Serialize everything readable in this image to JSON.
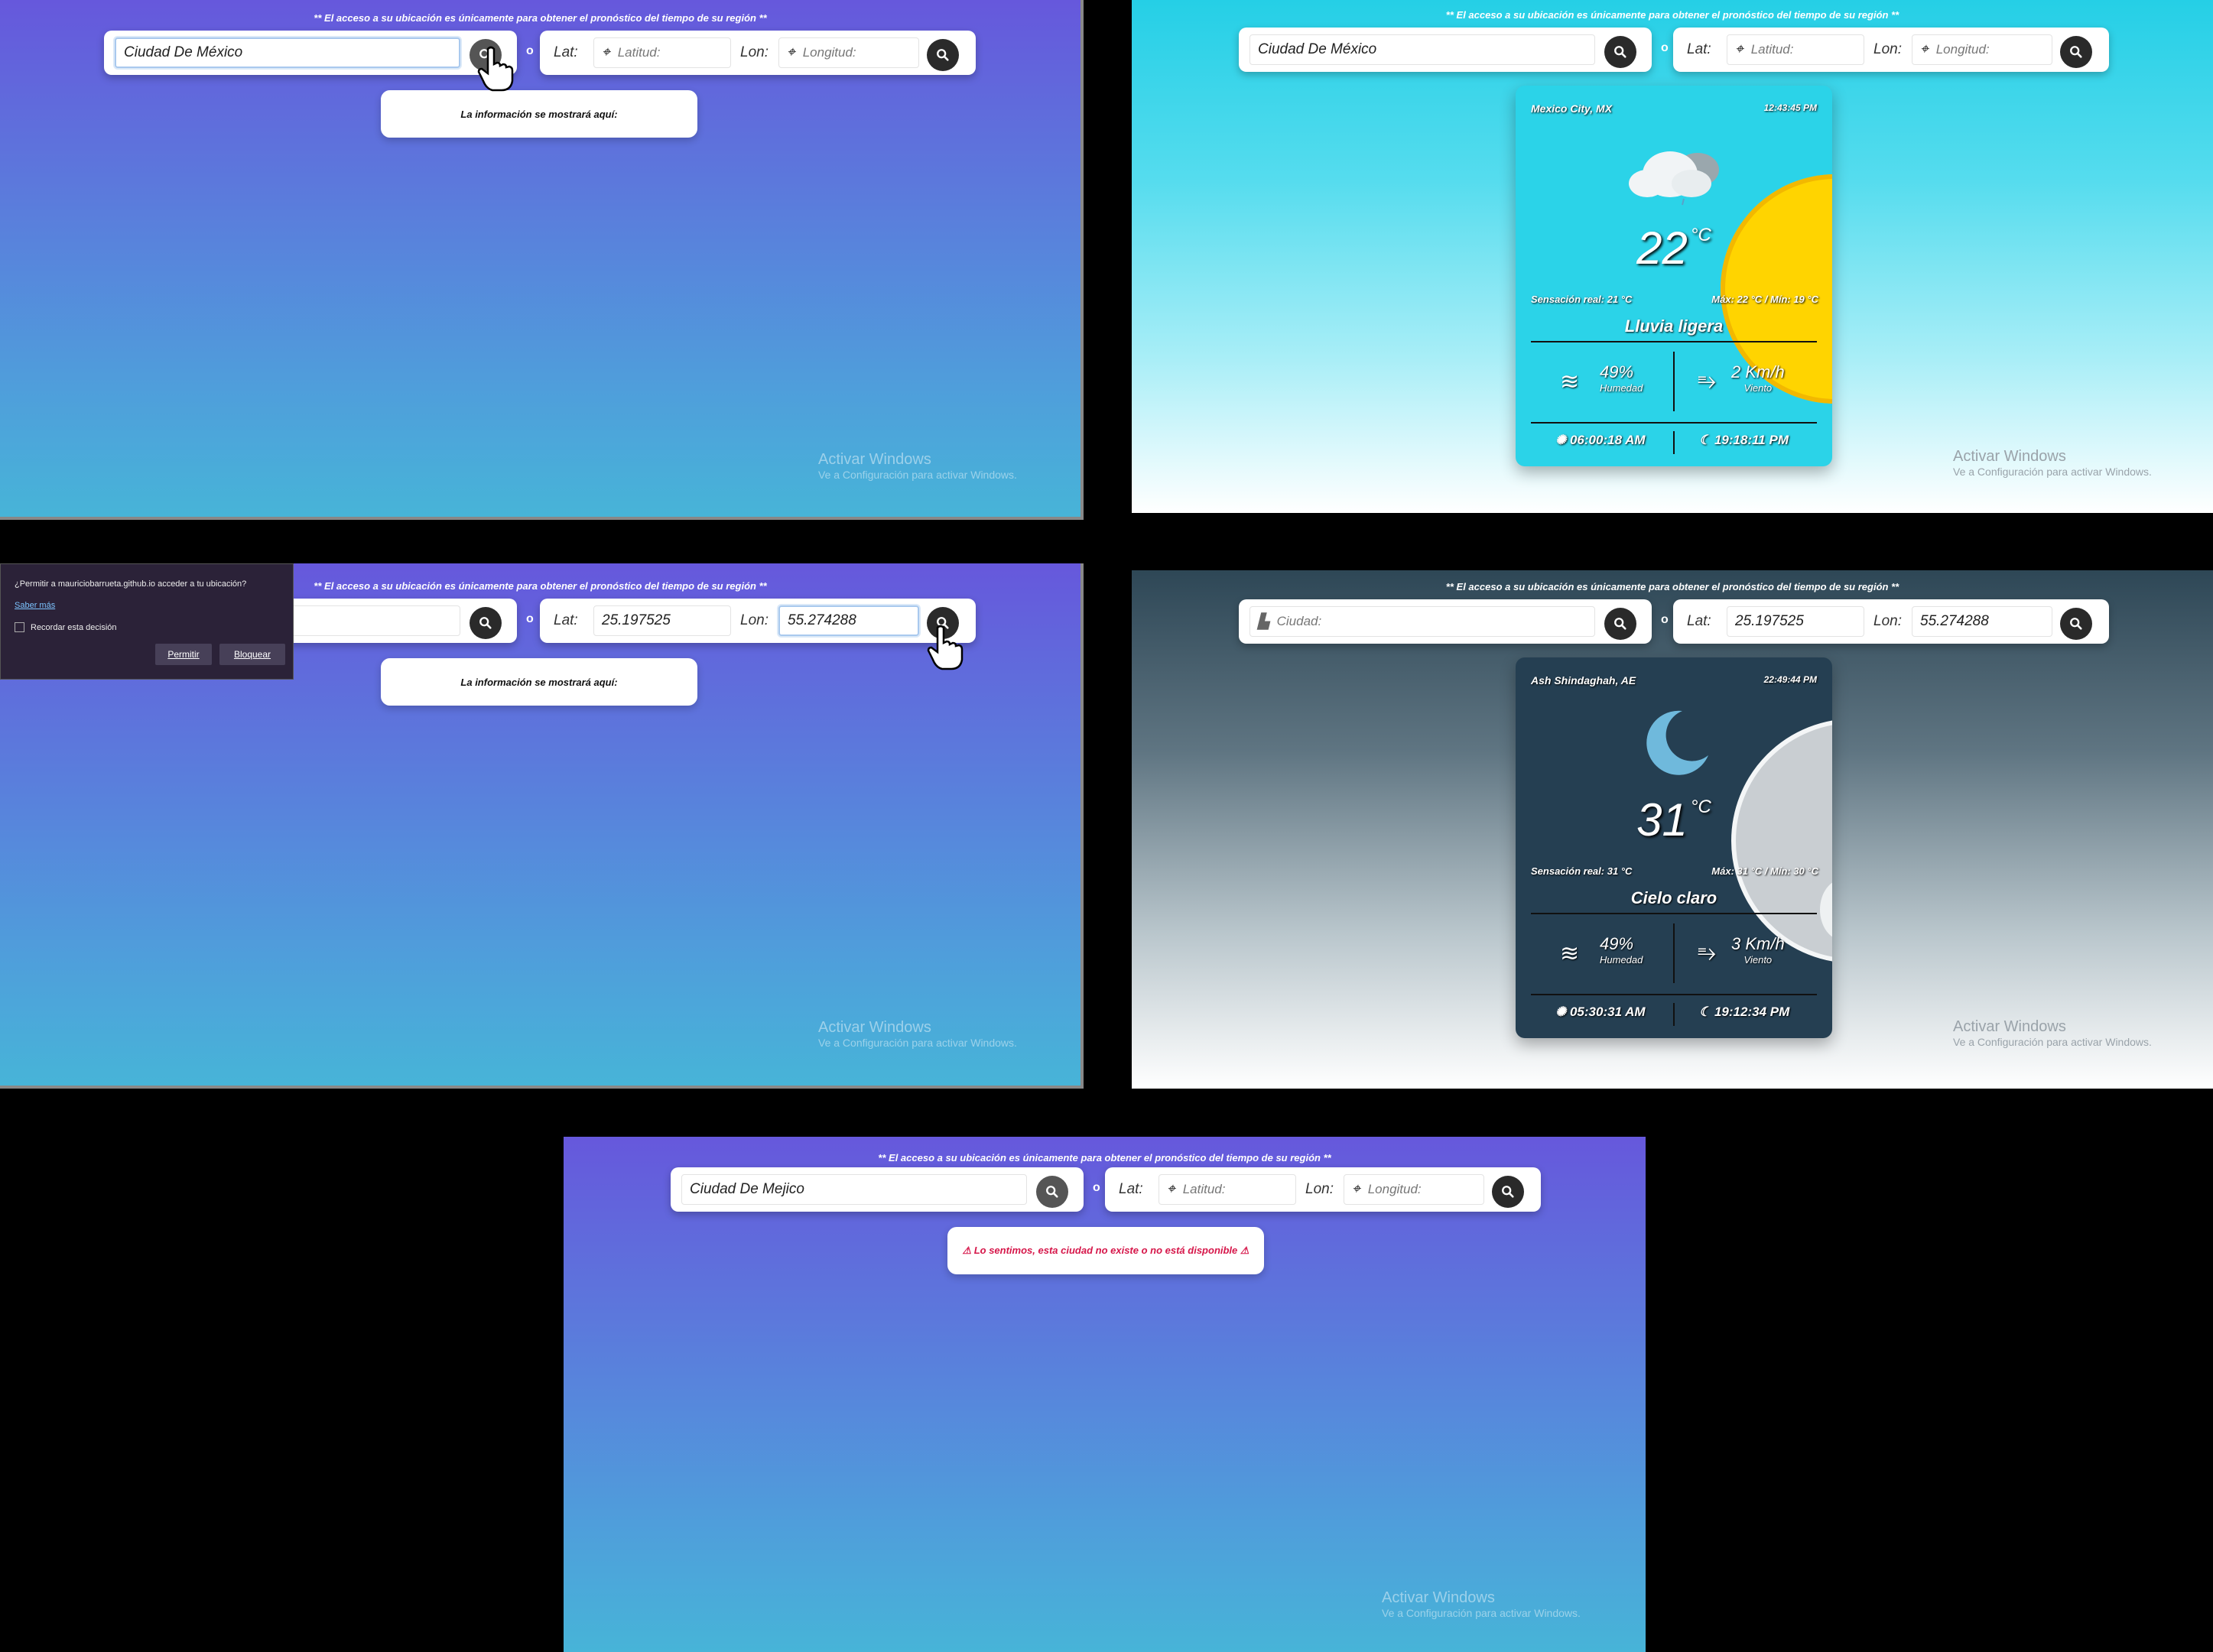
{
  "notice": "** El acceso a su ubicación es únicamente para obtener el pronóstico del tiempo de su región **",
  "separator": "o",
  "labels": {
    "lat": "Lat:",
    "lon": "Lon:"
  },
  "placeholders": {
    "city": "Ciudad:",
    "lat": "Latitud:",
    "lon": "Longitud:"
  },
  "info_default": "La información se mostrará aquí:",
  "watermark": {
    "title": "Activar Windows",
    "subtitle": "Ve a Configuración para activar Windows."
  },
  "panel1": {
    "city_value": "Ciudad De México"
  },
  "panel2": {
    "city_value": "Ciudad De México",
    "card": {
      "location": "Mexico City, MX",
      "time": "12:43:45 PM",
      "temp": "22",
      "unit": "°C",
      "feels_like": "Sensación real: 21 °C",
      "max_min": "Máx: 22 °C / Mín: 19 °C",
      "description": "Lluvia ligera",
      "humidity": "49%",
      "humidity_label": "Humedad",
      "wind": "2 Km/h",
      "wind_label": "Viento",
      "sunrise": "06:00:18 AM",
      "sunset": "19:18:11 PM",
      "weather_icon": "cloud-rain-icon",
      "colors": {
        "bg": "#2bd3e8",
        "sun": "#ffd400"
      }
    }
  },
  "panel3": {
    "lat_value": "25.197525",
    "lon_value": "55.274288",
    "dialog": {
      "question": "¿Permitir a mauriciobarrueta.github.io acceder a tu ubicación?",
      "learn_more": "Saber más",
      "remember": "Recordar esta decisión",
      "allow": "Permitir",
      "block": "Bloquear"
    }
  },
  "panel4": {
    "lat_value": "25.197525",
    "lon_value": "55.274288",
    "card": {
      "location": "Ash Shindaghah, AE",
      "time": "22:49:44 PM",
      "temp": "31",
      "unit": "°C",
      "feels_like": "Sensación real: 31 °C",
      "max_min": "Máx: 31 °C / Mín: 30 °C",
      "description": "Cielo claro",
      "humidity": "49%",
      "humidity_label": "Humedad",
      "wind": "3 Km/h",
      "wind_label": "Viento",
      "sunrise": "05:30:31 AM",
      "sunset": "19:12:34 PM",
      "weather_icon": "moon-icon",
      "colors": {
        "bg": "#253f52",
        "moon": "#6fb9dc"
      }
    }
  },
  "panel5": {
    "city_value": "Ciudad De Mejico",
    "error": "⚠ Lo sentimos, esta ciudad no existe o no está disponible ⚠"
  }
}
